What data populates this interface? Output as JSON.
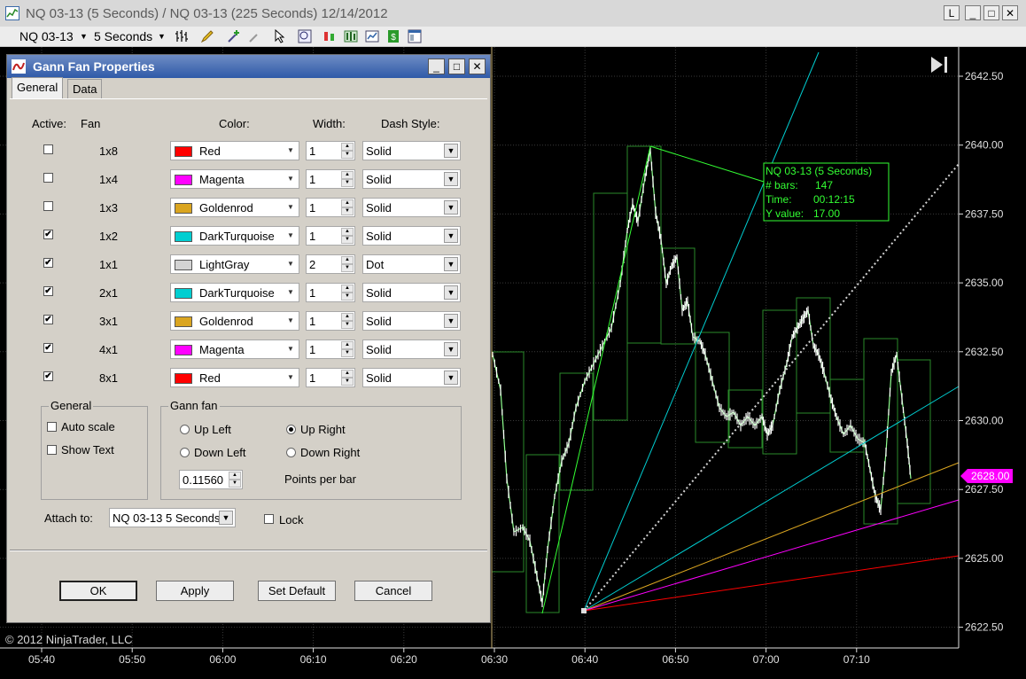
{
  "window": {
    "title": "NQ 03-13 (5 Seconds) / NQ 03-13 (225 Seconds)  12/14/2012",
    "buttons": [
      "L",
      "_",
      "□",
      "✕"
    ]
  },
  "toolbar": {
    "instrument": "NQ 03-13",
    "interval": "5 Seconds"
  },
  "chart": {
    "price_labels": [
      "2642.50",
      "2640.00",
      "2637.50",
      "2635.00",
      "2632.50",
      "2630.00",
      "2627.50",
      "2625.00",
      "2622.50"
    ],
    "time_labels": [
      "05:40",
      "05:50",
      "06:00",
      "06:10",
      "06:20",
      "06:30",
      "06:40",
      "06:50",
      "07:00",
      "07:10"
    ],
    "current_price": "2628.00",
    "info_box": {
      "line1": "NQ 03-13 (5 Seconds)",
      "line2_label": "# bars:",
      "line2_value": "147",
      "line3_label": "Time:",
      "line3_value": "00:12:15",
      "line4_label": "Y value:",
      "line4_value": "17.00"
    },
    "copyright": "© 2012 NinjaTrader, LLC",
    "colors": {
      "background": "#000000",
      "grid": "#3a3a3a",
      "bars": "#ffffff",
      "box": "#2a8a2a",
      "info": "#33ff33",
      "price_marker": "#ff00ff"
    }
  },
  "dialog": {
    "title": "Gann Fan Properties",
    "tabs": [
      "General",
      "Data"
    ],
    "headers": {
      "active": "Active:",
      "fan": "Fan",
      "color": "Color:",
      "width": "Width:",
      "dash": "Dash Style:"
    },
    "fans": [
      {
        "name": "1x8",
        "active": false,
        "color": "Red",
        "hex": "#ff0000",
        "width": "1",
        "dash": "Solid"
      },
      {
        "name": "1x4",
        "active": false,
        "color": "Magenta",
        "hex": "#ff00ff",
        "width": "1",
        "dash": "Solid"
      },
      {
        "name": "1x3",
        "active": false,
        "color": "Goldenrod",
        "hex": "#daa520",
        "width": "1",
        "dash": "Solid"
      },
      {
        "name": "1x2",
        "active": true,
        "color": "DarkTurquoise",
        "hex": "#00ced1",
        "width": "1",
        "dash": "Solid"
      },
      {
        "name": "1x1",
        "active": true,
        "color": "LightGray",
        "hex": "#d3d3d3",
        "width": "2",
        "dash": "Dot"
      },
      {
        "name": "2x1",
        "active": true,
        "color": "DarkTurquoise",
        "hex": "#00ced1",
        "width": "1",
        "dash": "Solid"
      },
      {
        "name": "3x1",
        "active": true,
        "color": "Goldenrod",
        "hex": "#daa520",
        "width": "1",
        "dash": "Solid"
      },
      {
        "name": "4x1",
        "active": true,
        "color": "Magenta",
        "hex": "#ff00ff",
        "width": "1",
        "dash": "Solid"
      },
      {
        "name": "8x1",
        "active": true,
        "color": "Red",
        "hex": "#ff0000",
        "width": "1",
        "dash": "Solid"
      }
    ],
    "general_group": {
      "label": "General",
      "auto_scale": "Auto scale",
      "show_text": "Show Text"
    },
    "gann_group": {
      "label": "Gann fan",
      "up_left": "Up Left",
      "up_right": "Up Right",
      "down_left": "Down Left",
      "down_right": "Down Right",
      "selected": "Up Right",
      "points_value": "0.11560",
      "points_label": "Points per bar"
    },
    "attach_label": "Attach to:",
    "attach_value": "NQ 03-13 5 Seconds",
    "lock_label": "Lock",
    "buttons": {
      "ok": "OK",
      "apply": "Apply",
      "set_default": "Set Default",
      "cancel": "Cancel"
    }
  }
}
